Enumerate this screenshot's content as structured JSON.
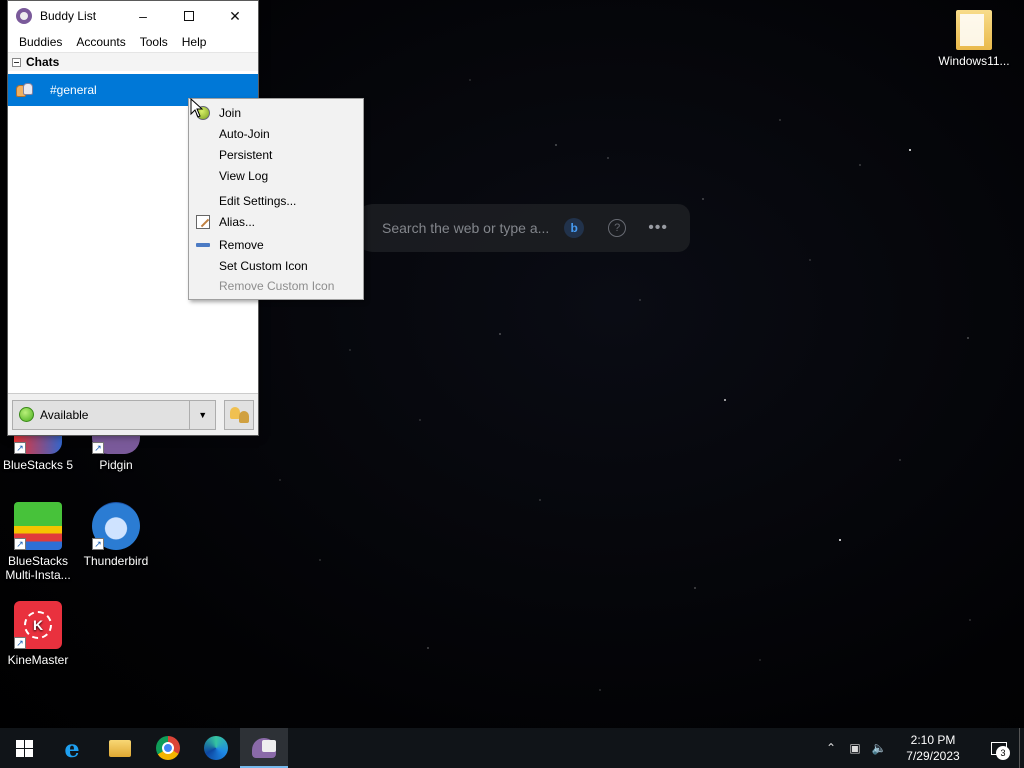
{
  "window": {
    "title": "Buddy List",
    "menu": [
      "Buddies",
      "Accounts",
      "Tools",
      "Help"
    ],
    "group": "Chats",
    "chat": "#general",
    "status": "Available"
  },
  "context_menu": {
    "items": [
      {
        "label": "Join",
        "icon": "join-icon",
        "enabled": true
      },
      {
        "label": "Auto-Join",
        "enabled": true
      },
      {
        "label": "Persistent",
        "enabled": true
      },
      {
        "label": "View Log",
        "enabled": true
      },
      {
        "label": "Edit Settings...",
        "enabled": true
      },
      {
        "label": "Alias...",
        "icon": "pencil-icon",
        "enabled": true
      },
      {
        "label": "Remove",
        "icon": "remove-icon",
        "enabled": true
      },
      {
        "label": "Set Custom Icon",
        "enabled": true
      },
      {
        "label": "Remove Custom Icon",
        "enabled": false
      }
    ]
  },
  "search": {
    "placeholder": "Search the web or type a...",
    "bing_letter": "b"
  },
  "desktop_icons": [
    {
      "label": "Windows11...",
      "icon": "folder-icon"
    },
    {
      "label": "BlueStacks 5",
      "icon": "bluestacks-icon"
    },
    {
      "label": "Pidgin",
      "icon": "pidgin-icon"
    },
    {
      "label": "BlueStacks Multi-Insta...",
      "icon": "bluestacks-multi-icon"
    },
    {
      "label": "Thunderbird",
      "icon": "thunderbird-icon"
    },
    {
      "label": "KineMaster",
      "icon": "kinemaster-icon"
    }
  ],
  "taskbar": {
    "apps": [
      "start-icon",
      "internet-explorer-icon",
      "file-explorer-icon",
      "chrome-icon",
      "edge-icon",
      "pidgin-icon"
    ],
    "time": "2:10 PM",
    "date": "7/29/2023",
    "notifications": "3"
  }
}
